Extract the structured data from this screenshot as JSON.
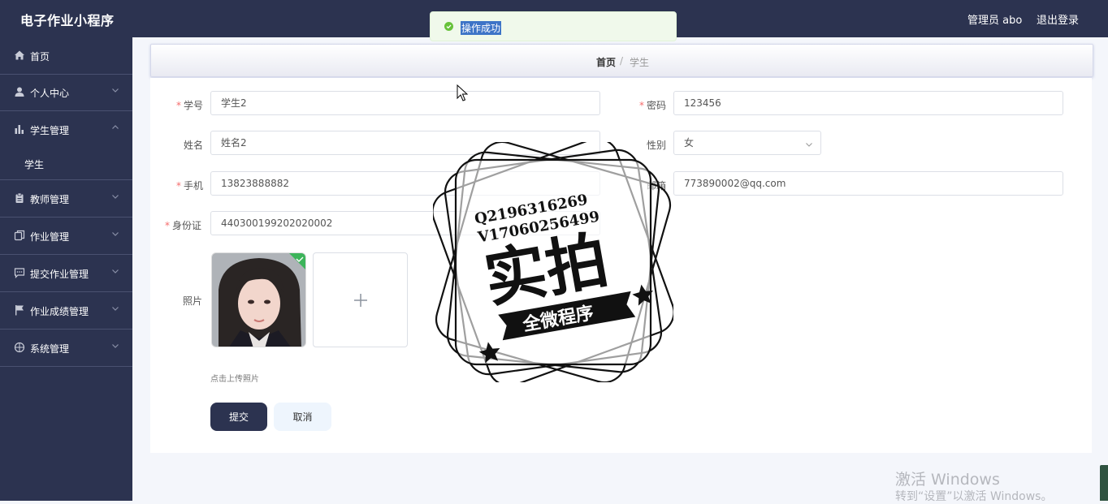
{
  "header": {
    "app_title": "电子作业小程序",
    "user": "管理员 abo",
    "logout": "退出登录"
  },
  "sidebar": {
    "items": [
      {
        "label": "首页",
        "icon": "home-icon"
      },
      {
        "label": "个人中心",
        "icon": "user-icon"
      },
      {
        "label": "学生管理",
        "icon": "bar-chart-icon",
        "expanded": true,
        "sub": [
          "学生"
        ]
      },
      {
        "label": "教师管理",
        "icon": "clipboard-icon"
      },
      {
        "label": "作业管理",
        "icon": "copy-icon"
      },
      {
        "label": "提交作业管理",
        "icon": "comment-icon"
      },
      {
        "label": "作业成绩管理",
        "icon": "flag-icon"
      },
      {
        "label": "系统管理",
        "icon": "compass-icon"
      }
    ]
  },
  "breadcrumb": {
    "home": "首页",
    "sep": "/",
    "current": "学生"
  },
  "form": {
    "student_id": {
      "label": "学号",
      "value": "学生2"
    },
    "password": {
      "label": "密码",
      "value": "123456"
    },
    "name": {
      "label": "姓名",
      "value": "姓名2"
    },
    "gender": {
      "label": "性别",
      "value": "女"
    },
    "phone": {
      "label": "手机",
      "value": "13823888882"
    },
    "email": {
      "label": "邮箱",
      "value": "773890002@qq.com"
    },
    "id_card": {
      "label": "身份证",
      "value": "440300199202020002"
    },
    "photo": {
      "label": "照片",
      "upload_tip": "点击上传照片"
    },
    "submit": "提交",
    "cancel": "取消"
  },
  "toast": {
    "text": "操作成功",
    "status_color": "#67c23a"
  },
  "watermark": {
    "line1": "Q2196316269",
    "line2": "V17060256499",
    "main": "实拍",
    "banner": "全微程序"
  },
  "windows_activation": {
    "line1": "激活 Windows",
    "line2": "转到“设置”以激活 Windows。"
  },
  "colors": {
    "sidebar_bg": "#2c3350",
    "accent": "#2c3350",
    "required": "#f56c6c"
  }
}
